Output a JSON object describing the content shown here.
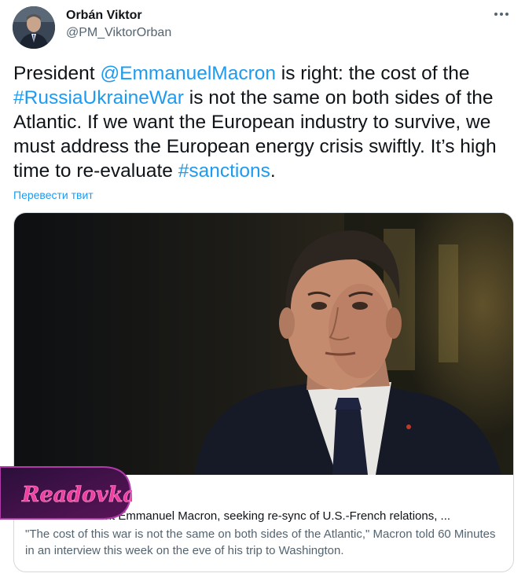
{
  "author": {
    "name": "Orbán Viktor",
    "handle": "@PM_ViktorOrban",
    "avatar_icon": "person-portrait-icon"
  },
  "menu": {
    "icon": "more-dots-icon"
  },
  "tweet": {
    "segments": [
      {
        "text": "President ",
        "link": false
      },
      {
        "text": "@EmmanuelMacron",
        "link": true
      },
      {
        "text": " is right: the cost of the ",
        "link": false
      },
      {
        "text": "#RussiaUkraineWar",
        "link": true
      },
      {
        "text": " is not the same on both sides of the Atlantic. If we want the European industry to survive, we must address the European energy crisis swiftly. It’s high time to re-evaluate ",
        "link": false
      },
      {
        "text": "#sanctions",
        "link": true
      },
      {
        "text": ".",
        "link": false
      }
    ],
    "link_color": "#1d9bf0"
  },
  "translate_label": "Перевести твит",
  "card": {
    "image_alt": "man-in-suit-photo",
    "title": "French President Emmanuel Macron, seeking re-sync of U.S.-French relations, ...",
    "description": "\"The cost of this war is not the same on both sides of the Atlantic,\" Macron told 60 Minutes in an interview this week on the eve of his trip to Washington."
  },
  "watermark": {
    "text": "Readovka",
    "color": "#e6348f"
  }
}
